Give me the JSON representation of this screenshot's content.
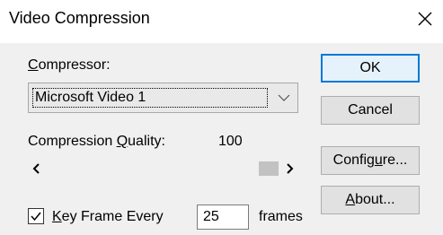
{
  "window": {
    "title": "Video Compression",
    "close_icon": "close-icon"
  },
  "compressor": {
    "label_accel": "C",
    "label_rest": "ompressor:",
    "selected": "Microsoft Video 1",
    "dropdown_icon": "chevron-down-icon"
  },
  "quality": {
    "label_pre": "Compression ",
    "label_accel": "Q",
    "label_post": "uality:",
    "value": "100",
    "slider_fraction": 1.0
  },
  "keyframe": {
    "checked": true,
    "label_accel": "K",
    "label_rest": "ey Frame Every",
    "value": "25",
    "units": "frames"
  },
  "buttons": {
    "ok": "OK",
    "cancel": "Cancel",
    "configure_pre": "Config",
    "configure_accel": "u",
    "configure_post": "re...",
    "about_accel": "A",
    "about_rest": "bout..."
  },
  "colors": {
    "accent": "#0078d7",
    "panel": "#f0f0f0"
  }
}
